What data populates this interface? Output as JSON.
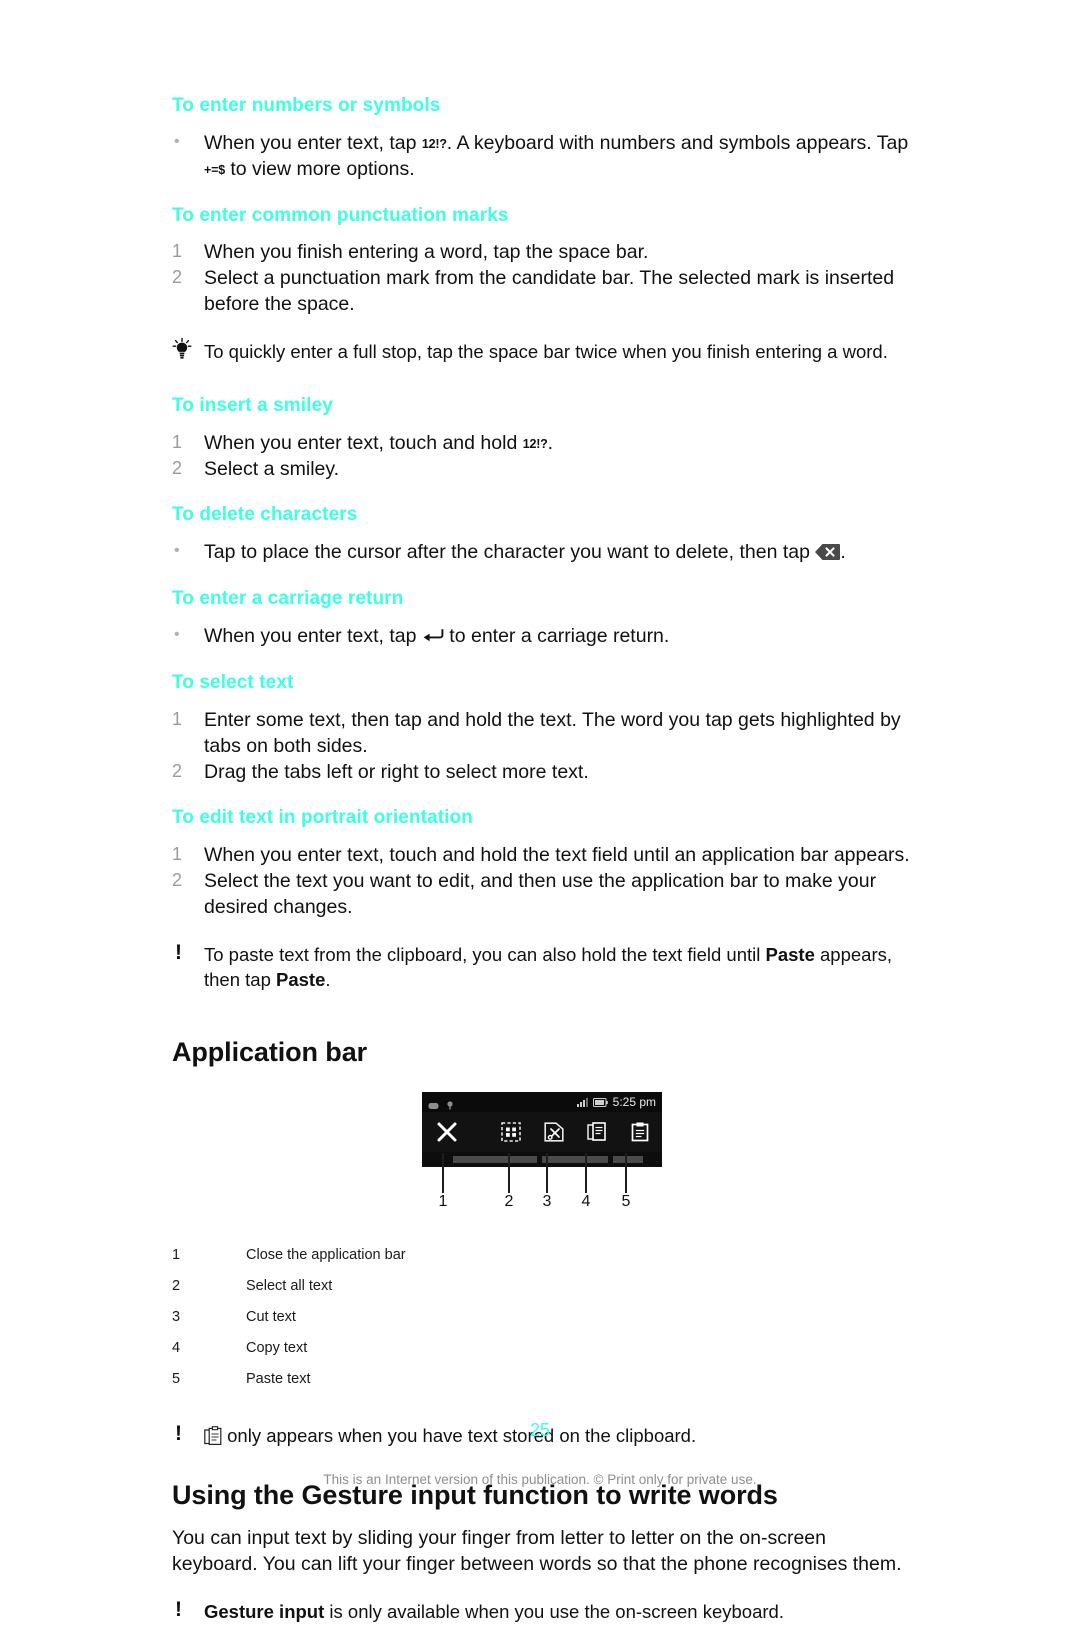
{
  "document": {
    "page_number": "25",
    "footer_note": "This is an Internet version of this publication. © Print only for private use."
  },
  "sections": [
    {
      "heading": "To enter numbers or symbols",
      "marker_type": "bullet",
      "items": [
        {
          "marker": "•",
          "text_before": "When you enter text, tap ",
          "key1": "12!?",
          "text_mid": ". A keyboard with numbers and symbols appears. Tap ",
          "key2": "+=$",
          "text_after": " to view more options."
        }
      ]
    },
    {
      "heading": "To enter common punctuation marks",
      "marker_type": "number",
      "items": [
        {
          "marker": "1",
          "text": "When you finish entering a word, tap the space bar."
        },
        {
          "marker": "2",
          "text": "Select a punctuation mark from the candidate bar. The selected mark is inserted before the space."
        }
      ]
    },
    {
      "heading": "To insert a smiley",
      "marker_type": "number",
      "items": [
        {
          "marker": "1",
          "text_before": "When you enter text, touch and hold ",
          "key1": "12!?",
          "text_after": "."
        },
        {
          "marker": "2",
          "text": "Select a smiley."
        }
      ]
    },
    {
      "heading": "To delete characters",
      "marker_type": "bullet",
      "items": [
        {
          "marker": "•",
          "text_before": "Tap to place the cursor after the character you want to delete, then tap ",
          "icon": "backspace-key-icon",
          "text_after": "."
        }
      ]
    },
    {
      "heading": "To enter a carriage return",
      "marker_type": "bullet",
      "items": [
        {
          "marker": "•",
          "text_before": "When you enter text, tap ",
          "icon": "return-key-icon",
          "text_after": " to enter a carriage return."
        }
      ]
    },
    {
      "heading": "To select text",
      "marker_type": "number",
      "items": [
        {
          "marker": "1",
          "text": "Enter some text, then tap and hold the text. The word you tap gets highlighted by tabs on both sides."
        },
        {
          "marker": "2",
          "text": "Drag the tabs left or right to select more text."
        }
      ]
    },
    {
      "heading": "To edit text in portrait orientation",
      "marker_type": "number",
      "items": [
        {
          "marker": "1",
          "text": "When you enter text, touch and hold the text field until an application bar appears."
        },
        {
          "marker": "2",
          "text": "Select the text you want to edit, and then use the application bar to make your desired changes."
        }
      ]
    }
  ],
  "tips": {
    "full_stop_tip": "To quickly enter a full stop, tap the space bar twice when you finish entering a word.",
    "paste_note_before": "To paste text from the clipboard, you can also hold the text field until ",
    "paste_note_bold1": "Paste",
    "paste_note_mid": " appears, then tap ",
    "paste_note_bold2": "Paste",
    "paste_note_after": ".",
    "clipboard_note_after": " only appears when you have text stored on the clipboard."
  },
  "application_bar": {
    "title": "Application bar",
    "screenshot": {
      "status_time": "5:25 pm",
      "status_icons_left": [
        "message-icon",
        "usb-icon"
      ],
      "status_icons_right": [
        "signal-icon",
        "battery-icon"
      ],
      "bar_icons": [
        "close-icon",
        "select-all-icon",
        "cut-icon",
        "copy-icon",
        "paste-icon"
      ],
      "callout_numbers": [
        "1",
        "2",
        "3",
        "4",
        "5"
      ]
    },
    "legend": [
      {
        "num": "1",
        "desc": "Close the application bar"
      },
      {
        "num": "2",
        "desc": "Select all text"
      },
      {
        "num": "3",
        "desc": "Cut text"
      },
      {
        "num": "4",
        "desc": "Copy text"
      },
      {
        "num": "5",
        "desc": "Paste text"
      }
    ]
  },
  "gesture_section": {
    "title": "Using the Gesture input function to write words",
    "paragraph": "You can input text by sliding your finger from letter to letter on the on-screen keyboard. You can lift your finger between words so that the phone recognises them.",
    "note_bold": "Gesture input",
    "note_rest": " is only available when you use the on-screen keyboard."
  },
  "colors": {
    "heading_cyan": "#3dffe2",
    "text_black": "#111111",
    "marker_gray": "#9a9a9a",
    "footer_gray": "#8e8e8e"
  }
}
